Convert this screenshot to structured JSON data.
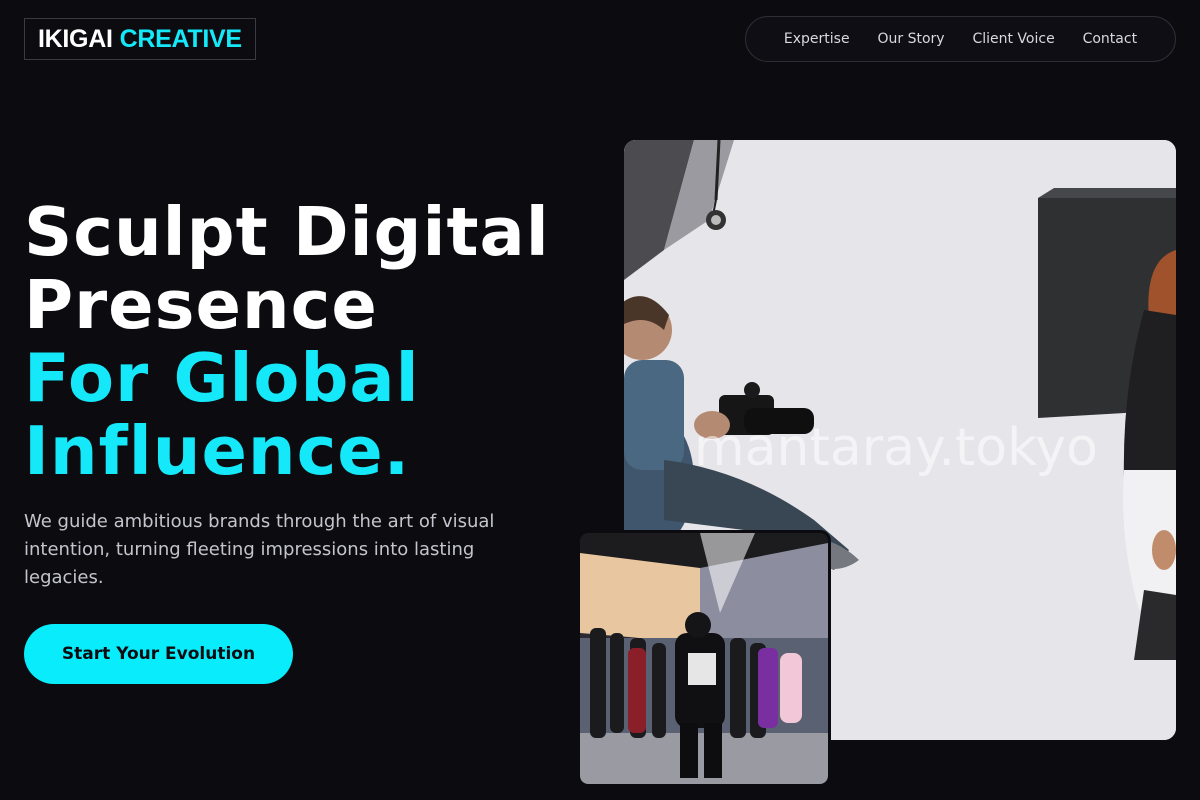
{
  "brand": {
    "name": "IKIGAI",
    "accent": "CREATIVE"
  },
  "nav": {
    "items": [
      {
        "label": "Expertise"
      },
      {
        "label": "Our Story"
      },
      {
        "label": "Client Voice"
      },
      {
        "label": "Contact"
      }
    ]
  },
  "hero": {
    "headline_line1": "Sculpt Digital",
    "headline_line2": "Presence",
    "headline_accent_line1": "For Global",
    "headline_accent_line2": "Influence.",
    "subcopy": "We guide ambitious brands through the art of visual intention, turning fleeting impressions into lasting legacies.",
    "cta_label": "Start Your Evolution"
  },
  "images": {
    "main_watermark": "mantaray.tokyo"
  },
  "colors": {
    "accent": "#15e8f8",
    "background": "#0b0b10",
    "cta_background": "#08ecfb"
  }
}
